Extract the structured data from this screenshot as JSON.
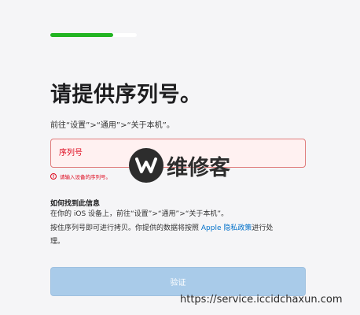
{
  "progress": {
    "fraction": 0.73,
    "fill_color": "#22b422"
  },
  "title": "请提供序列号。",
  "subtitle": "前往“设置”>“通用”>“关于本机”。",
  "serial_input": {
    "placeholder": "序列号",
    "value": ""
  },
  "error": {
    "icon": "alert-circle-icon",
    "text": "请输入设备的序列号。",
    "color": "#de071c"
  },
  "watermark": {
    "icon": "w-logo-icon",
    "text": "维修客"
  },
  "help": {
    "heading": "如何找到此信息",
    "line1": "在你的 iOS 设备上，前往“设置”>“通用”>“关于本机”。",
    "line2_before": "按住序列号即可进行拷贝。你提供的数据将按照 ",
    "line2_link": "Apple 隐私政策",
    "line2_after": "进行处",
    "line3": "理。"
  },
  "verify_button": {
    "label": "验证"
  },
  "url_watermark": "https://service.iccidchaxun.com"
}
